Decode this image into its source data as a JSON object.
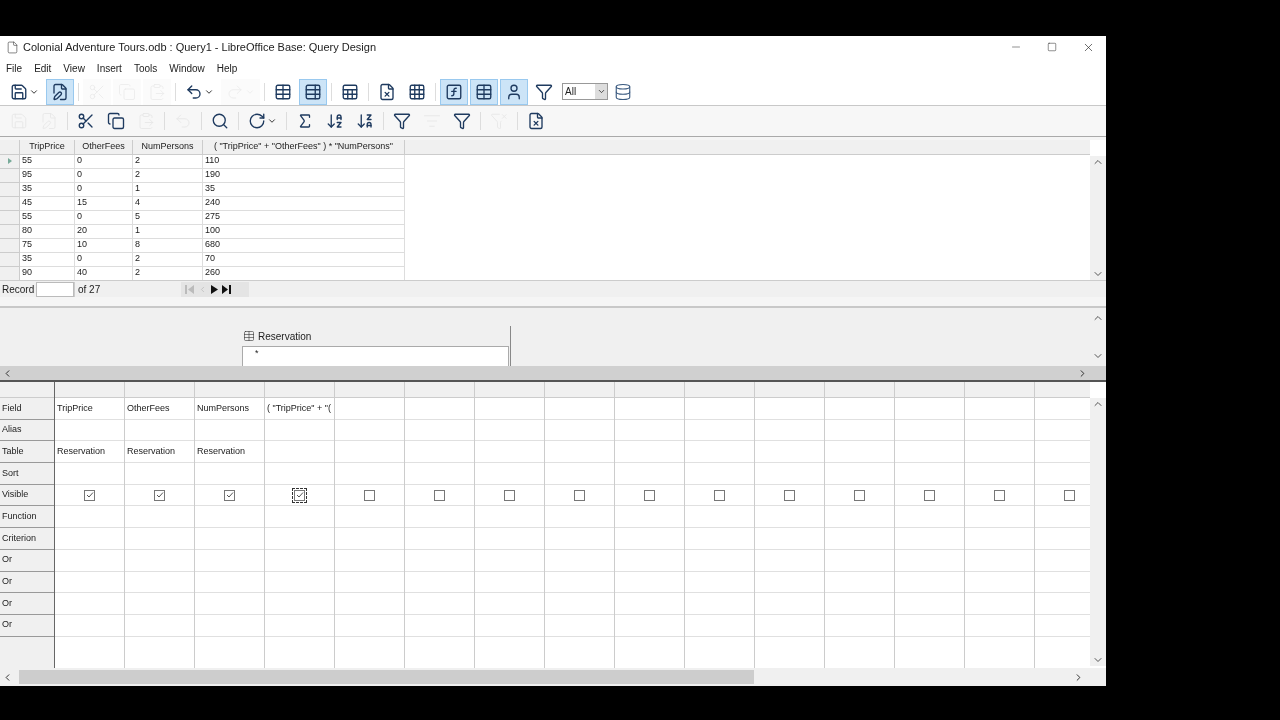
{
  "window": {
    "title": "Colonial Adventure Tours.odb : Query1 - LibreOffice Base: Query Design"
  },
  "menu": [
    "File",
    "Edit",
    "View",
    "Insert",
    "Tools",
    "Window",
    "Help"
  ],
  "toolbar": [
    {
      "selected": false,
      "disabled": false
    },
    {
      "selected": true,
      "disabled": false
    },
    {
      "selected": false,
      "disabled": true
    },
    {
      "selected": false,
      "disabled": true
    },
    {
      "selected": false,
      "disabled": true
    },
    {
      "selected": false,
      "disabled": false
    },
    {
      "selected": false,
      "disabled": true
    },
    {
      "selected": false,
      "disabled": false
    },
    {
      "selected": true,
      "disabled": false
    },
    {
      "selected": false,
      "disabled": false
    },
    {
      "selected": false,
      "disabled": false
    },
    {
      "selected": false,
      "disabled": false
    },
    {
      "selected": true,
      "disabled": false
    },
    {
      "selected": true,
      "disabled": false
    },
    {
      "selected": true,
      "disabled": false
    },
    {
      "selected": false,
      "disabled": false
    }
  ],
  "limit_box": {
    "value": "All"
  },
  "toolbar_2": [
    {
      "disabled": true
    },
    {
      "disabled": true
    },
    {
      "disabled": false
    },
    {
      "disabled": false
    },
    {
      "disabled": true
    },
    {
      "disabled": true
    },
    {
      "disabled": false
    },
    {
      "disabled": false
    },
    {
      "disabled": false
    },
    {
      "disabled": false
    },
    {
      "disabled": false
    },
    {
      "disabled": false
    },
    {
      "disabled": true
    },
    {
      "disabled": false
    },
    {
      "disabled": true
    },
    {
      "disabled": false
    }
  ],
  "results": {
    "columns": [
      "TripPrice",
      "OtherFees",
      "NumPersons",
      "( \"TripPrice\" + \"OtherFees\" ) * \"NumPersons\""
    ],
    "rows": [
      {
        "selected": true,
        "cells": [
          "55",
          "0",
          "2",
          "110"
        ]
      },
      {
        "selected": false,
        "cells": [
          "95",
          "0",
          "2",
          "190"
        ]
      },
      {
        "selected": false,
        "cells": [
          "35",
          "0",
          "1",
          "35"
        ]
      },
      {
        "selected": false,
        "cells": [
          "45",
          "15",
          "4",
          "240"
        ]
      },
      {
        "selected": false,
        "cells": [
          "55",
          "0",
          "5",
          "275"
        ]
      },
      {
        "selected": false,
        "cells": [
          "80",
          "20",
          "1",
          "100"
        ]
      },
      {
        "selected": false,
        "cells": [
          "75",
          "10",
          "8",
          "680"
        ]
      },
      {
        "selected": false,
        "cells": [
          "35",
          "0",
          "2",
          "70"
        ]
      },
      {
        "selected": false,
        "cells": [
          "90",
          "40",
          "2",
          "260"
        ]
      }
    ]
  },
  "record_nav": {
    "label": "Record",
    "count": "of 27"
  },
  "design": {
    "table": {
      "title": "Reservation",
      "fields": [
        "*"
      ]
    }
  },
  "query_grid": {
    "row_labels": [
      "Field",
      "Alias",
      "Table",
      "Sort",
      "Visible",
      "Function",
      "Criterion",
      "Or",
      "Or",
      "Or",
      "Or"
    ],
    "columns": [
      {
        "field": "TripPrice",
        "table": "Reservation",
        "visible": true,
        "focused": false
      },
      {
        "field": "OtherFees",
        "table": "Reservation",
        "visible": true,
        "focused": false
      },
      {
        "field": "NumPersons",
        "table": "Reservation",
        "visible": true,
        "focused": false
      },
      {
        "field": "( \"TripPrice\" + \"(",
        "visible": true,
        "focused": true
      },
      {
        "visible": false,
        "focused": false
      },
      {
        "visible": false,
        "focused": false
      },
      {
        "visible": false,
        "focused": false
      },
      {
        "visible": false,
        "focused": false
      },
      {
        "visible": false,
        "focused": false
      },
      {
        "visible": false,
        "focused": false
      },
      {
        "visible": false,
        "focused": false
      },
      {
        "visible": false,
        "focused": false
      },
      {
        "visible": false,
        "focused": false
      },
      {
        "visible": false,
        "focused": false
      },
      {
        "visible": false,
        "focused": false
      }
    ]
  }
}
